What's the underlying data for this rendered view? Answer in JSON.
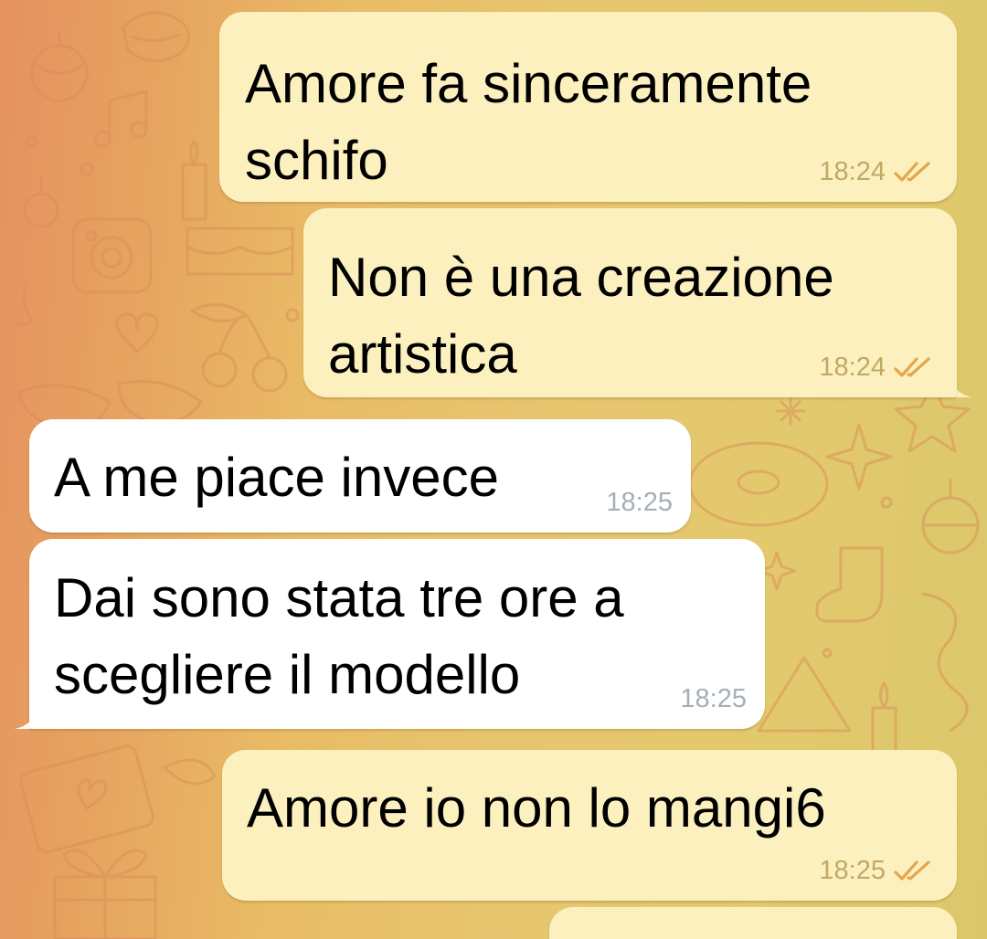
{
  "theme": {
    "outgoing_bubble": "#fcf1be",
    "incoming_bubble": "#ffffff",
    "check_color": "#e3a64c",
    "pattern_color": "#d88c58"
  },
  "messages": [
    {
      "direction": "outgoing",
      "text": "Amore fa sinceramente\nschifo",
      "time": "18:24",
      "status": "read",
      "status_icon": "double-check-icon"
    },
    {
      "direction": "outgoing",
      "text": "Non è una creazione\nartistica",
      "time": "18:24",
      "status": "read",
      "status_icon": "double-check-icon"
    },
    {
      "direction": "incoming",
      "text": "A me piace invece",
      "time": "18:25"
    },
    {
      "direction": "incoming",
      "text": "Dai sono stata tre ore a\nscegliere il modello",
      "time": "18:25"
    },
    {
      "direction": "outgoing",
      "text": "Amore io non lo mangi6",
      "time": "18:25",
      "status": "read",
      "status_icon": "double-check-icon"
    }
  ]
}
